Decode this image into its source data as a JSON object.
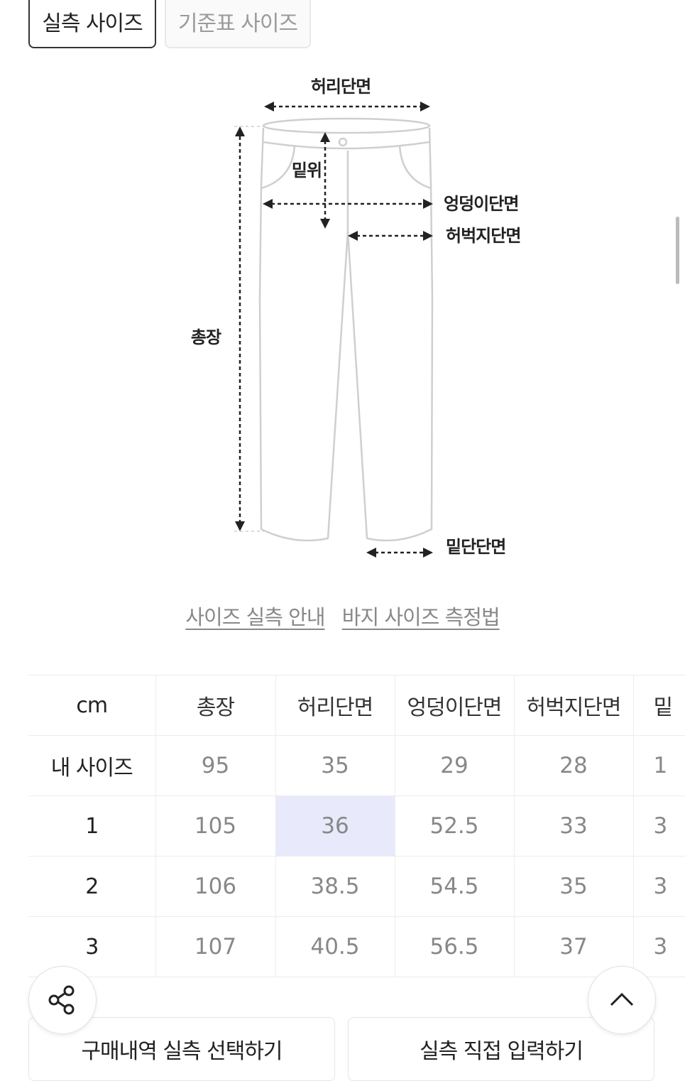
{
  "tabs": {
    "actual": "실측 사이즈",
    "standard": "기준표 사이즈"
  },
  "diagram": {
    "waist": "허리단면",
    "rise": "밑위",
    "hip": "엉덩이단면",
    "thigh": "허벅지단면",
    "length": "총장",
    "hem": "밑단단면"
  },
  "links": {
    "guide": "사이즈 실측 안내",
    "method": "바지 사이즈 측정법"
  },
  "table": {
    "headers": [
      "cm",
      "총장",
      "허리단면",
      "엉덩이단면",
      "허벅지단면",
      "밑"
    ],
    "rows": [
      [
        "내 사이즈",
        "95",
        "35",
        "29",
        "28",
        "1"
      ],
      [
        "1",
        "105",
        "36",
        "52.5",
        "33",
        "3"
      ],
      [
        "2",
        "106",
        "38.5",
        "54.5",
        "35",
        "3"
      ],
      [
        "3",
        "107",
        "40.5",
        "56.5",
        "37",
        "3"
      ]
    ]
  },
  "buttons": {
    "buy_history": "구매내역 실측 선택하기",
    "direct_input": "실측 직접 입력하기"
  },
  "icons": {
    "share": "share-icon",
    "scroll_top": "chevron-up-icon"
  },
  "colors": {
    "highlight": "#e8eafb",
    "muted_text": "#888888",
    "link_text": "#888888"
  }
}
